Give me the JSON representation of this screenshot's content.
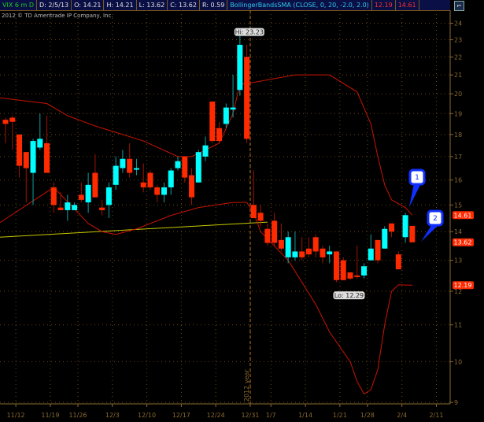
{
  "header": {
    "symbol": "VIX 6 m D",
    "date": "D: 2/5/13",
    "open": "O: 14.21",
    "high": "H: 14.21",
    "low": "L: 13.62",
    "close": "C: 13.62",
    "range": "R: 0.59",
    "study": "BollingerBandsSMA (CLOSE, 0, 20, -2.0, 2.0)",
    "lower_band": "12.19",
    "upper_band": "14.61"
  },
  "copyright": "2012 © TD Ameritrade IP Company, Inc.",
  "colors": {
    "up": "#00ffff",
    "down": "#ff2a00",
    "band": "#c81400",
    "trend": "#c8c800",
    "grid": "#6a4a10",
    "callout": "#1030ff"
  },
  "y_axis": {
    "scale": "log",
    "ticks": [
      9,
      10,
      11,
      12,
      13,
      14,
      15,
      16,
      17,
      18,
      19,
      20,
      21,
      22,
      23,
      24
    ]
  },
  "x_axis": {
    "labels": [
      "11/12",
      "11/19",
      "11/26",
      "12/3",
      "12/10",
      "12/17",
      "12/24",
      "12/31",
      "1/7",
      "1/14",
      "1/21",
      "1/28",
      "2/4",
      "2/11"
    ],
    "label_candle_index": [
      1.5,
      6.5,
      10.5,
      15.5,
      20.5,
      25.5,
      30.5,
      35.5,
      38.5,
      43.5,
      48.5,
      52.5,
      57.5,
      62.5
    ],
    "year_marker": "2012 year"
  },
  "price_badges": [
    {
      "value": "14.61",
      "price": 14.61
    },
    {
      "value": "13.62",
      "price": 13.62
    },
    {
      "value": "12.19",
      "price": 12.19
    }
  ],
  "hi_label": "Hi: 23.23",
  "lo_label": "Lo: 12.29",
  "callouts": [
    {
      "label": "1"
    },
    {
      "label": "2"
    }
  ],
  "candles": [
    [
      18.7,
      18.8,
      17.6,
      18.5
    ],
    [
      18.8,
      18.9,
      17.3,
      18.6
    ],
    [
      18.0,
      18.0,
      16.1,
      16.6
    ],
    [
      17.2,
      17.2,
      15.1,
      16.5
    ],
    [
      16.3,
      17.8,
      15.0,
      17.7
    ],
    [
      17.4,
      19.0,
      17.3,
      17.8
    ],
    [
      17.6,
      18.9,
      16.3,
      16.3
    ],
    [
      15.7,
      15.9,
      14.7,
      15.0
    ],
    [
      14.9,
      15.5,
      14.8,
      14.8
    ],
    [
      14.8,
      15.4,
      14.4,
      15.1
    ],
    [
      14.8,
      15.1,
      14.8,
      15.0
    ],
    [
      15.4,
      15.9,
      15.1,
      15.2
    ],
    [
      15.1,
      16.3,
      14.7,
      15.8
    ],
    [
      16.3,
      17.1,
      15.3,
      15.3
    ],
    [
      14.9,
      15.2,
      14.6,
      14.8
    ],
    [
      15.0,
      15.9,
      14.5,
      15.7
    ],
    [
      15.8,
      17.0,
      15.6,
      16.6
    ],
    [
      16.5,
      17.3,
      16.3,
      16.9
    ],
    [
      16.9,
      17.6,
      16.1,
      16.3
    ],
    [
      16.5,
      16.9,
      16.2,
      16.5
    ],
    [
      15.9,
      16.7,
      15.5,
      15.7
    ],
    [
      16.3,
      16.4,
      15.6,
      15.7
    ],
    [
      15.7,
      15.8,
      15.1,
      15.4
    ],
    [
      15.4,
      15.9,
      15.1,
      15.7
    ],
    [
      15.7,
      16.5,
      15.4,
      16.4
    ],
    [
      16.5,
      17.0,
      16.4,
      16.8
    ],
    [
      17.0,
      17.0,
      15.9,
      16.1
    ],
    [
      16.2,
      16.5,
      15.0,
      15.3
    ],
    [
      15.9,
      17.3,
      15.9,
      17.2
    ],
    [
      17.0,
      17.9,
      16.8,
      17.5
    ],
    [
      19.6,
      19.6,
      17.6,
      17.7
    ],
    [
      18.3,
      18.6,
      17.6,
      17.7
    ],
    [
      18.5,
      19.5,
      18.3,
      19.3
    ],
    [
      19.2,
      21.0,
      18.8,
      19.3
    ],
    [
      20.2,
      23.23,
      19.9,
      22.7
    ],
    [
      22.0,
      22.7,
      17.6,
      17.8
    ],
    [
      15.0,
      16.4,
      14.5,
      14.5
    ],
    [
      14.7,
      15.0,
      14.2,
      14.4
    ],
    [
      14.1,
      14.3,
      13.5,
      13.6
    ],
    [
      14.4,
      14.7,
      13.5,
      13.6
    ],
    [
      13.7,
      14.3,
      13.3,
      13.4
    ],
    [
      13.1,
      14.0,
      12.9,
      13.8
    ],
    [
      13.1,
      14.0,
      13.0,
      13.3
    ],
    [
      13.3,
      13.8,
      13.0,
      13.1
    ],
    [
      13.4,
      13.8,
      13.1,
      13.2
    ],
    [
      13.8,
      13.9,
      13.1,
      13.3
    ],
    [
      13.4,
      13.5,
      12.9,
      13.1
    ],
    [
      13.2,
      13.5,
      12.9,
      13.3
    ],
    [
      13.3,
      13.3,
      12.29,
      12.35
    ],
    [
      13.0,
      13.1,
      12.35,
      12.35
    ],
    [
      12.6,
      12.6,
      12.35,
      12.4
    ],
    [
      12.5,
      13.5,
      12.4,
      12.45
    ],
    [
      12.5,
      12.9,
      12.4,
      12.8
    ],
    [
      13.0,
      13.9,
      13.0,
      13.4
    ],
    [
      13.7,
      13.7,
      12.9,
      13.0
    ],
    [
      13.4,
      14.2,
      13.4,
      14.1
    ],
    [
      14.3,
      14.3,
      13.8,
      14.0
    ],
    [
      13.2,
      13.3,
      12.7,
      12.7
    ],
    [
      13.8,
      14.7,
      13.6,
      14.61
    ],
    [
      14.21,
      14.21,
      13.62,
      13.62
    ]
  ],
  "upper_band": [
    [
      -1,
      19.8
    ],
    [
      6,
      19.5
    ],
    [
      9,
      18.9
    ],
    [
      13,
      18.4
    ],
    [
      16,
      18.1
    ],
    [
      20,
      17.7
    ],
    [
      25,
      17.0
    ],
    [
      27,
      17.0
    ],
    [
      31,
      17.6
    ],
    [
      33,
      19.0
    ],
    [
      34,
      20.5
    ],
    [
      36,
      20.6
    ],
    [
      42,
      21.0
    ],
    [
      47,
      21.0
    ],
    [
      51,
      20.1
    ],
    [
      53,
      18.5
    ],
    [
      54,
      17.0
    ],
    [
      55,
      15.8
    ],
    [
      56,
      15.2
    ],
    [
      58,
      14.9
    ],
    [
      59,
      14.61
    ]
  ],
  "lower_band": [
    [
      -1,
      14.3
    ],
    [
      7,
      15.7
    ],
    [
      12,
      14.3
    ],
    [
      14,
      14.0
    ],
    [
      16,
      13.9
    ],
    [
      19,
      14.1
    ],
    [
      24,
      14.6
    ],
    [
      28,
      14.9
    ],
    [
      33,
      15.1
    ],
    [
      35,
      15.1
    ],
    [
      36,
      14.7
    ],
    [
      37,
      14.0
    ],
    [
      41,
      13.0
    ],
    [
      45,
      11.6
    ],
    [
      47,
      10.8
    ],
    [
      50,
      10.0
    ],
    [
      51,
      9.5
    ],
    [
      52,
      9.2
    ],
    [
      53,
      9.3
    ],
    [
      54,
      9.8
    ],
    [
      55,
      11.0
    ],
    [
      56,
      12.0
    ],
    [
      57,
      12.2
    ],
    [
      59,
      12.19
    ]
  ],
  "trendline": [
    [
      -1,
      13.8
    ],
    [
      38,
      14.35
    ]
  ]
}
